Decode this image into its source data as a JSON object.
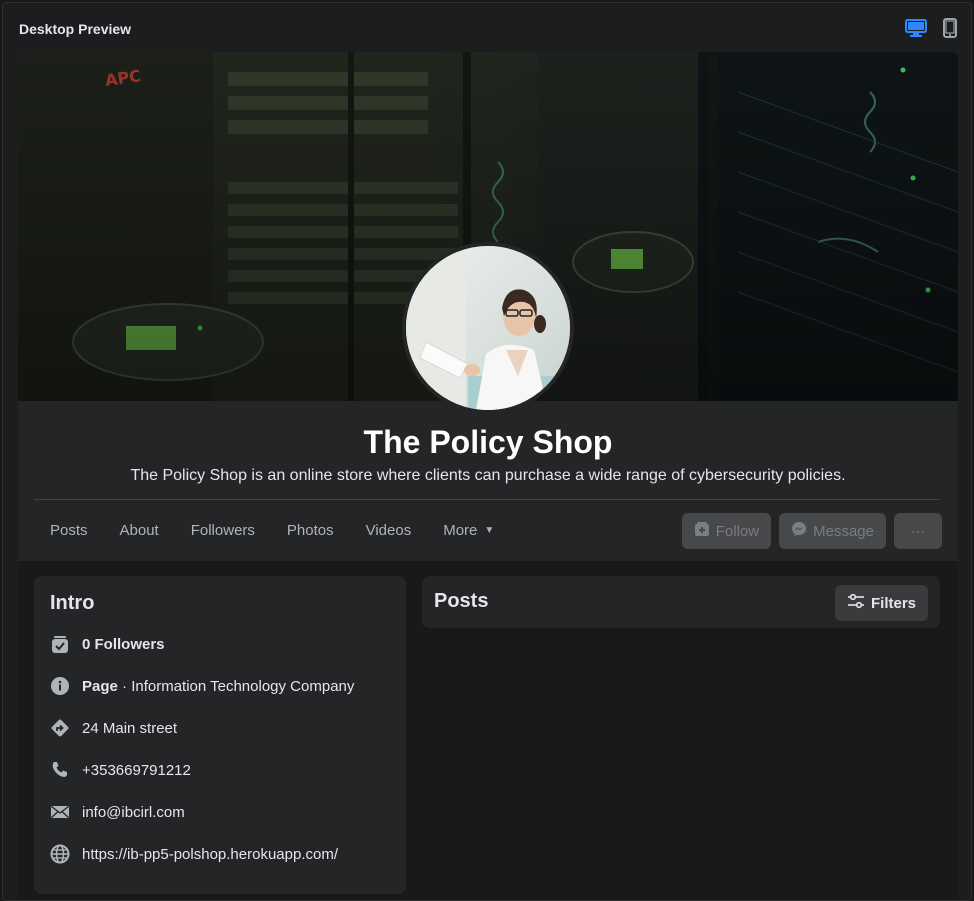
{
  "preview": {
    "title": "Desktop Preview",
    "devices": [
      {
        "name": "desktop",
        "active": true
      },
      {
        "name": "mobile",
        "active": false
      }
    ],
    "active_color": "#2d88ff"
  },
  "profile": {
    "name": "The Policy Shop",
    "description": "The Policy Shop is an online store where clients can purchase a wide range of cybersecurity policies.",
    "tabs": [
      {
        "label": "Posts"
      },
      {
        "label": "About"
      },
      {
        "label": "Followers"
      },
      {
        "label": "Photos"
      },
      {
        "label": "Videos"
      },
      {
        "label": "More"
      }
    ],
    "actions": {
      "follow": "Follow",
      "message": "Message",
      "more": "···"
    }
  },
  "intro": {
    "title": "Intro",
    "followers": "0 Followers",
    "category_prefix": "Page",
    "category": " · Information Technology Company",
    "address": "24 Main street",
    "phone": "+353669791212",
    "email": "info@ibcirl.com",
    "website": "https://ib-pp5-polshop.herokuapp.com/"
  },
  "posts": {
    "title": "Posts",
    "filters_label": "Filters"
  }
}
